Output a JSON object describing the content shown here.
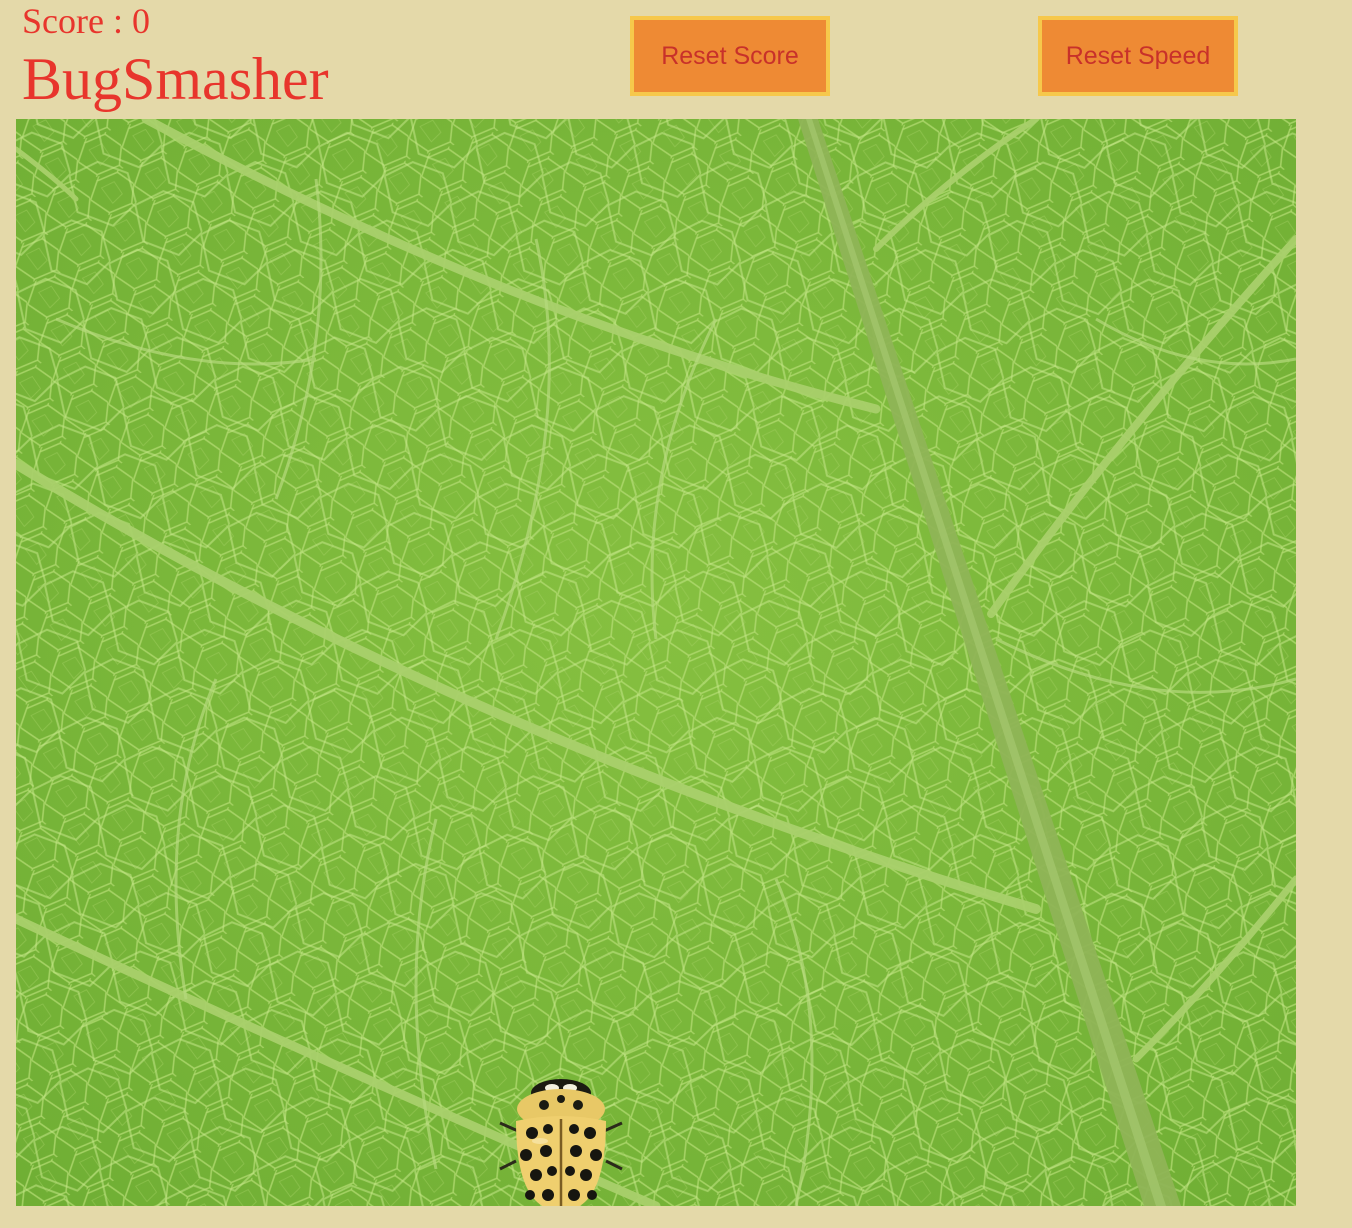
{
  "game": {
    "score_label": "Score : ",
    "score": 0,
    "score_text": "Score : 0",
    "title": "BugSmasher"
  },
  "buttons": {
    "reset_score": "Reset Score",
    "reset_speed": "Reset Speed"
  },
  "board": {
    "background": "leaf-texture",
    "sprite": "ladybug-icon"
  },
  "colors": {
    "page_bg": "#e4d9a9",
    "text": "#e8352c",
    "button_bg": "#ee8a34",
    "button_border": "#f6c84b",
    "button_text": "#c8312a",
    "leaf": "#7bb63b"
  }
}
